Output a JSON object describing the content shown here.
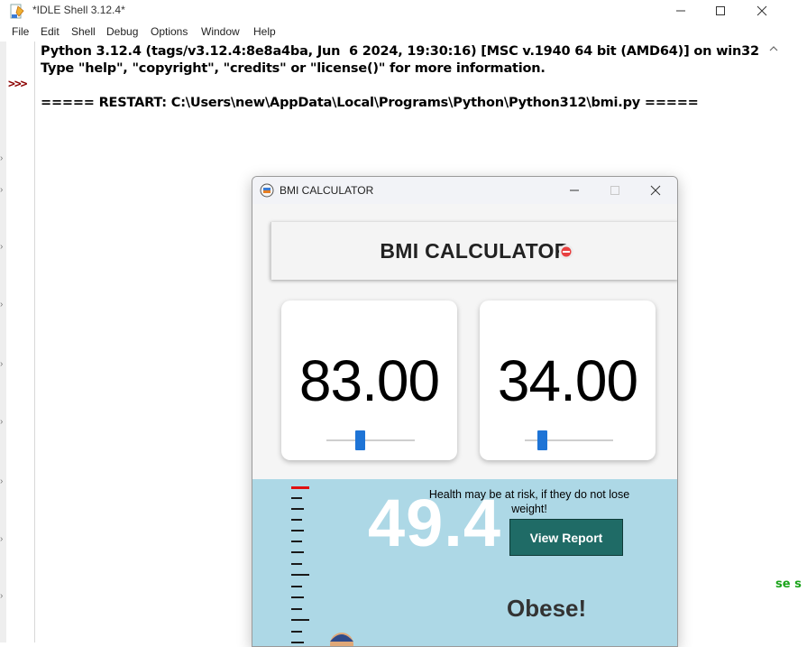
{
  "idle": {
    "title": "*IDLE Shell 3.12.4*",
    "menu": [
      "File",
      "Edit",
      "Shell",
      "Debug",
      "Options",
      "Window",
      "Help"
    ],
    "prompt": ">>>",
    "shell_lines": [
      "Python 3.12.4 (tags/v3.12.4:8e8a4ba, Jun  6 2024, 19:30:16) [MSC v.1940 64 bit (AMD64)] on win32",
      "Type \"help\", \"copyright\", \"credits\" or \"license()\" for more information.",
      "===== RESTART: C:\\Users\\new\\AppData\\Local\\Programs\\Python\\Python312\\bmi.py ====="
    ],
    "green_fragment": "se s"
  },
  "bmi": {
    "window_title": "BMI CALCULATOR",
    "heading": "BMI CALCULATOR",
    "weight_value": "83.00",
    "height_value": "34.00",
    "bmi_value": "49.4",
    "message": "Health may be at risk, if they do not lose weight!",
    "report_button": "View Report",
    "status": "Obese!"
  },
  "icons": {
    "idle_app": "idle-feather-icon",
    "bmi_app": "bmi-logo-icon",
    "heading_overlay": "scale-icon"
  },
  "colors": {
    "prompt": "#8b0000",
    "result_panel": "#add8e6",
    "report_button": "#1f6b66",
    "slider_thumb": "#1e74d6",
    "ruler_top": "#e01010",
    "green_text": "#1aa31a"
  }
}
